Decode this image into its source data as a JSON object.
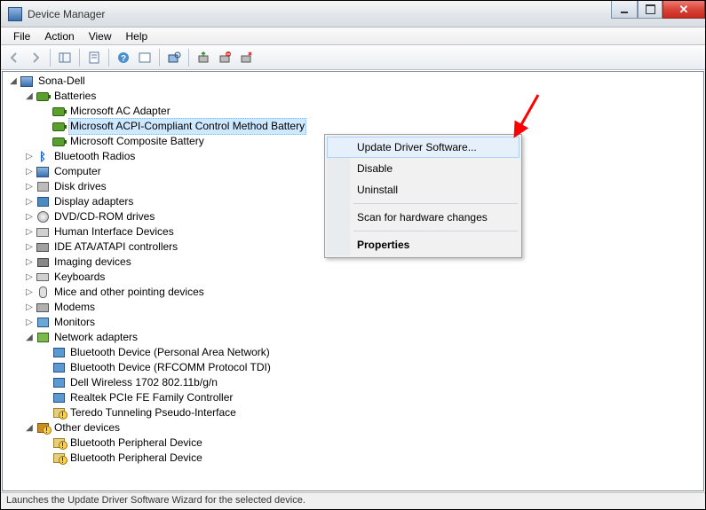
{
  "window": {
    "title": "Device Manager"
  },
  "menu": {
    "file": "File",
    "action": "Action",
    "view": "View",
    "help": "Help"
  },
  "tree": {
    "root": "Sona-Dell",
    "batteries": {
      "label": "Batteries",
      "items": [
        "Microsoft AC Adapter",
        "Microsoft ACPI-Compliant Control Method Battery",
        "Microsoft Composite Battery"
      ]
    },
    "bluetooth": "Bluetooth Radios",
    "computer": "Computer",
    "disk": "Disk drives",
    "display": "Display adapters",
    "dvd": "DVD/CD-ROM drives",
    "hid": "Human Interface Devices",
    "ide": "IDE ATA/ATAPI controllers",
    "imaging": "Imaging devices",
    "keyboards": "Keyboards",
    "mice": "Mice and other pointing devices",
    "modems": "Modems",
    "monitors": "Monitors",
    "network": {
      "label": "Network adapters",
      "items": [
        "Bluetooth Device (Personal Area Network)",
        "Bluetooth Device (RFCOMM Protocol TDI)",
        "Dell Wireless 1702 802.11b/g/n",
        "Realtek PCIe FE Family Controller",
        "Teredo Tunneling Pseudo-Interface"
      ]
    },
    "other": {
      "label": "Other devices",
      "items": [
        "Bluetooth Peripheral Device",
        "Bluetooth Peripheral Device"
      ]
    }
  },
  "context_menu": {
    "update": "Update Driver Software...",
    "disable": "Disable",
    "uninstall": "Uninstall",
    "scan": "Scan for hardware changes",
    "properties": "Properties"
  },
  "status": "Launches the Update Driver Software Wizard for the selected device."
}
